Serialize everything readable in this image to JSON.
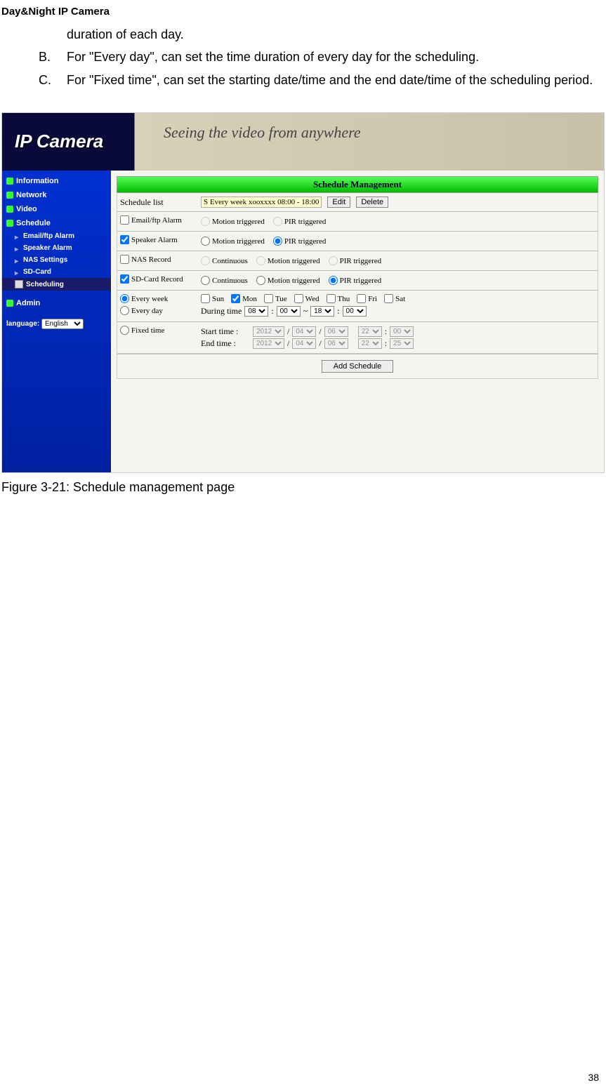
{
  "header": "Day&Night IP Camera",
  "text": {
    "line1": "duration of each day.",
    "itemB_marker": "B.",
    "itemB": "For \"Every day\", can set the time duration of every day for the scheduling.",
    "itemC_marker": "C.",
    "itemC": "For \"Fixed time\", can set the starting date/time and the end date/time of the scheduling period."
  },
  "screenshot": {
    "logo": "IP Camera",
    "tagline": "Seeing the video from anywhere",
    "nav": {
      "information": "Information",
      "network": "Network",
      "video": "Video",
      "schedule": "Schedule",
      "sub": {
        "emailftp": "Email/ftp Alarm",
        "speaker": "Speaker Alarm",
        "nas": "NAS Settings",
        "sdcard": "SD-Card",
        "scheduling": "Scheduling"
      },
      "admin": "Admin",
      "language_label": "language:",
      "language_value": "English"
    },
    "main": {
      "title": "Schedule Management",
      "schedule_list_label": "Schedule list",
      "schedule_list_item": "S Every week xooxxxx 08:00 - 18:00",
      "edit_btn": "Edit",
      "delete_btn": "Delete",
      "email_alarm": "Email/ftp Alarm",
      "speaker_alarm": "Speaker Alarm",
      "nas_record": "NAS Record",
      "sd_record": "SD-Card Record",
      "motion_triggered": "Motion triggered",
      "pir_triggered": "PIR triggered",
      "continuous": "Continuous",
      "every_week": "Every week",
      "every_day": "Every day",
      "days": {
        "sun": "Sun",
        "mon": "Mon",
        "tue": "Tue",
        "wed": "Wed",
        "thu": "Thu",
        "fri": "Fri",
        "sat": "Sat"
      },
      "during_time": "During time",
      "during_start_h": "08",
      "during_start_m": "00",
      "during_end_h": "18",
      "during_end_m": "00",
      "fixed_time": "Fixed time",
      "start_time_label": "Start time  :",
      "end_time_label": "End time  :",
      "start": {
        "year": "2012",
        "month": "04",
        "day": "06",
        "hour": "22",
        "min": "00"
      },
      "end": {
        "year": "2012",
        "month": "04",
        "day": "06",
        "hour": "22",
        "min": "25"
      },
      "add_schedule": "Add Schedule"
    }
  },
  "figure_caption": "Figure 3-21: Schedule management page",
  "page_number": "38"
}
